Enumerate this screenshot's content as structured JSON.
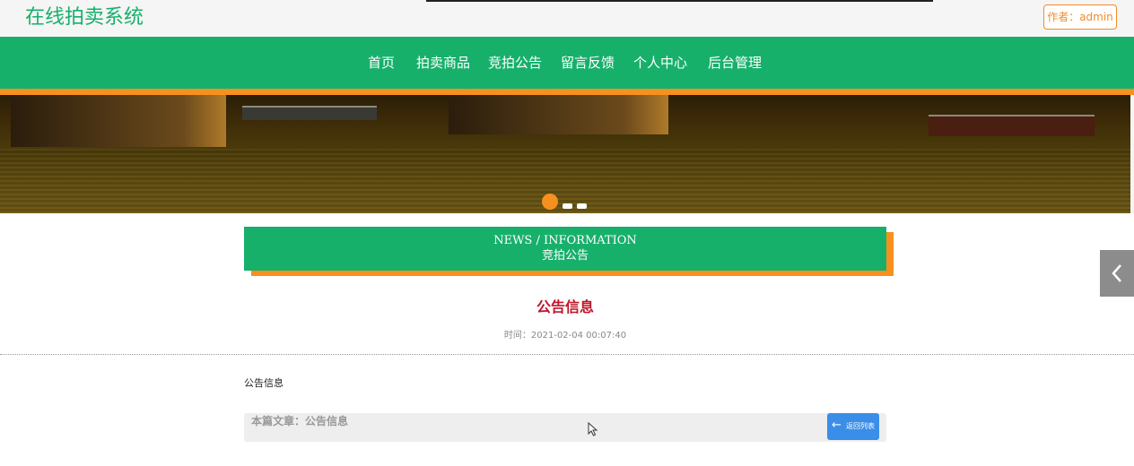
{
  "header": {
    "site_title": "在线拍卖系统",
    "author_label": "作者：admin"
  },
  "nav": {
    "items": [
      "首页",
      "拍卖商品",
      "竞拍公告",
      "留言反馈",
      "个人中心",
      "后台管理"
    ]
  },
  "banner": {
    "slides": 3,
    "active_slide": 1
  },
  "section": {
    "title_en": "NEWS / INFORMATION",
    "title_cn": "竞拍公告"
  },
  "article": {
    "title": "公告信息",
    "time": "时间：2021-02-04 00:07:40",
    "body": "公告信息"
  },
  "footer_bar": {
    "current_article": "本篇文章：公告信息",
    "back_button": "返回列表"
  },
  "colors": {
    "brand_green": "#17b06b",
    "accent_orange": "#f7901e",
    "title_red": "#c0142b",
    "button_blue": "#3a8ee8"
  },
  "icons": {
    "back": "arrow-left-icon",
    "side_tab": "chevron-left-icon"
  }
}
